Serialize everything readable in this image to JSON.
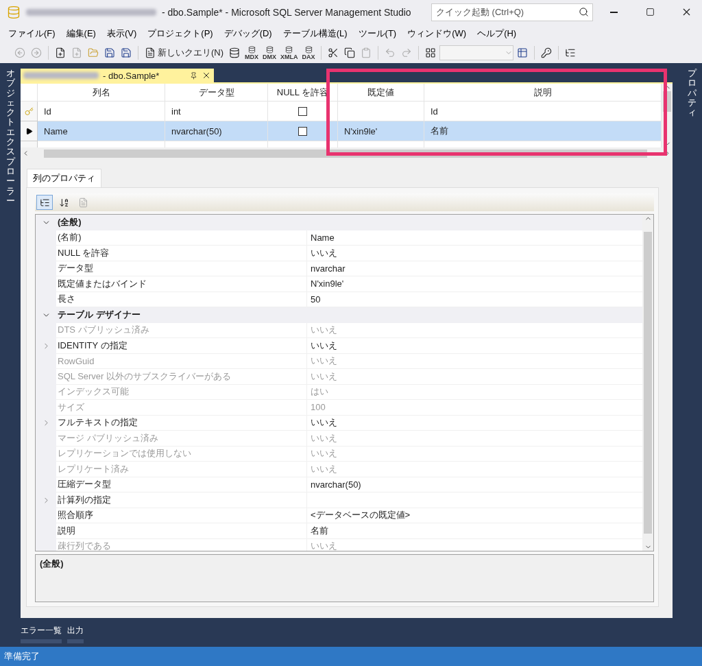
{
  "window": {
    "title": "- dbo.Sample* - Microsoft SQL Server Management Studio",
    "quick_launch": {
      "placeholder": "クイック起動 (Ctrl+Q)"
    }
  },
  "menu": [
    "ファイル(F)",
    "編集(E)",
    "表示(V)",
    "プロジェクト(P)",
    "デバッグ(D)",
    "テーブル構造(L)",
    "ツール(T)",
    "ウィンドウ(W)",
    "ヘルプ(H)"
  ],
  "toolbar": {
    "new_query": "新しいクエリ(N)",
    "query_types": [
      "MDX",
      "DMX",
      "XMLA",
      "DAX"
    ]
  },
  "side_tabs": {
    "left": "オブジェクトエクスプローラー",
    "right": "プロパティ"
  },
  "document_tab": {
    "title": "- dbo.Sample*",
    "selected": true
  },
  "table": {
    "columns": [
      "列名",
      "データ型",
      "NULL を許容",
      "既定値",
      "説明"
    ],
    "rows": [
      {
        "kind": "key",
        "selected": false,
        "name": "Id",
        "type": "int",
        "allow_null": false,
        "description": "Id"
      },
      {
        "kind": "current",
        "selected": true,
        "name": "Name",
        "type": "nvarchar(50)",
        "allow_null": false,
        "default": "N'xin9le'",
        "description": "名前"
      }
    ]
  },
  "properties": {
    "tab": {
      "label": "列のプロパティ",
      "selected": true
    },
    "categories": [
      {
        "label": "(全般)",
        "expanded": true,
        "children": [
          {
            "name": "(名前)",
            "value": "Name",
            "disabled": false
          },
          {
            "name": "NULL を許容",
            "value": "いいえ",
            "disabled": false
          },
          {
            "name": "データ型",
            "value": "nvarchar",
            "disabled": false
          },
          {
            "name": "既定値またはバインド",
            "value": "N'xin9le'",
            "disabled": false
          },
          {
            "name": "長さ",
            "value": "50",
            "disabled": false
          }
        ]
      },
      {
        "label": "テーブル デザイナー",
        "expanded": true,
        "children": [
          {
            "name": "DTS パブリッシュ済み",
            "value": "いいえ",
            "disabled": true
          },
          {
            "name": "IDENTITY の指定",
            "value": "いいえ",
            "disabled": false,
            "expanded": false
          },
          {
            "name": "RowGuid",
            "value": "いいえ",
            "disabled": true
          },
          {
            "name": "SQL Server 以外のサブスクライバーがある",
            "value": "いいえ",
            "disabled": true
          },
          {
            "name": "インデックス可能",
            "value": "はい",
            "disabled": true
          },
          {
            "name": "サイズ",
            "value": "100",
            "disabled": true
          },
          {
            "name": "フルテキストの指定",
            "value": "いいえ",
            "disabled": false,
            "expanded": false
          },
          {
            "name": "マージ パブリッシュ済み",
            "value": "いいえ",
            "disabled": true
          },
          {
            "name": "レプリケーションでは使用しない",
            "value": "いいえ",
            "disabled": true
          },
          {
            "name": "レプリケート済み",
            "value": "いいえ",
            "disabled": true
          },
          {
            "name": "圧縮データ型",
            "value": "nvarchar(50)",
            "disabled": false
          },
          {
            "name": "計算列の指定",
            "disabled": false,
            "expanded": false
          },
          {
            "name": "照合順序",
            "value": "<データベースの既定値>",
            "disabled": false
          },
          {
            "name": "説明",
            "value": "名前",
            "disabled": false
          },
          {
            "name": "疎行列である",
            "value": "いいえ",
            "disabled": true
          }
        ]
      }
    ],
    "description": "(全般)"
  },
  "bottom_tabs": [
    {
      "label": "エラー一覧",
      "selected": false
    },
    {
      "label": "出力",
      "selected": false
    }
  ],
  "status_bar": "準備完了"
}
